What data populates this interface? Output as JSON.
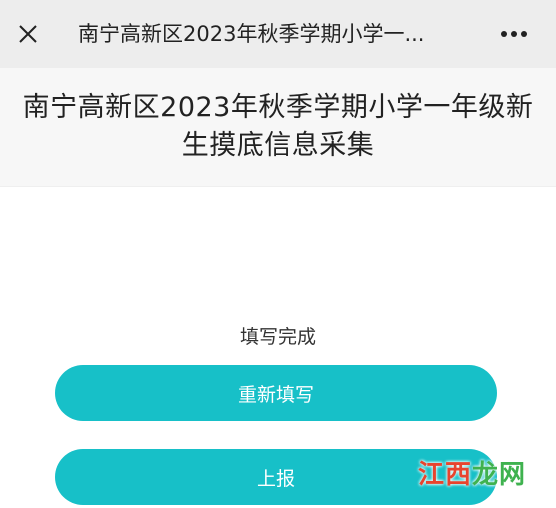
{
  "top_bar": {
    "close_icon": "close-icon",
    "title": "南宁高新区2023年秋季学期小学一...",
    "more_icon": "more-dots-icon"
  },
  "form": {
    "title": "南宁高新区2023年秋季学期小学一年级新生摸底信息采集"
  },
  "result": {
    "status_text": "填写完成",
    "refill_label": "重新填写",
    "submit_label": "上报",
    "button_color": "#17c0c8"
  },
  "watermark": {
    "part1": "江西",
    "part2": "龙网"
  }
}
